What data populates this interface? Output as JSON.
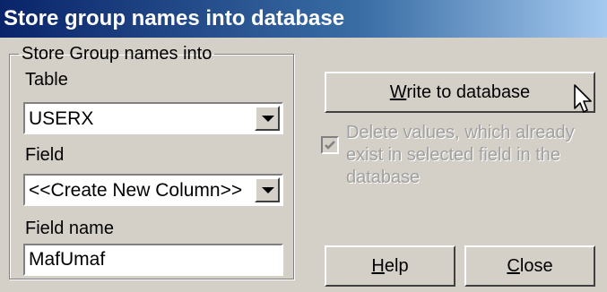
{
  "window": {
    "title": "Store group names into database"
  },
  "group": {
    "legend": "Store Group names into",
    "table_label": "Table",
    "table_value": "USERX",
    "field_label": "Field",
    "field_value": "<<Create New Column>>",
    "field_name_label": "Field name",
    "field_name_value": "MafUmaf"
  },
  "buttons": {
    "write_mnemonic": "W",
    "write_rest": "rite to database",
    "help_mnemonic": "H",
    "help_rest": "elp",
    "close_mnemonic": "C",
    "close_rest": "lose"
  },
  "options": {
    "delete_existing_label": "Delete values, which already exist in selected field in the database",
    "delete_existing_checked": true,
    "delete_existing_enabled": false
  },
  "colors": {
    "title_gradient_start": "#0a246a",
    "title_gradient_end": "#a6caf0",
    "dialog_bg": "#d4d0c8",
    "disabled_text": "#a0a0a0"
  },
  "icons": {
    "dropdown": "chevron-down-icon",
    "checkmark": "check-icon",
    "cursor": "mouse-pointer-icon"
  }
}
